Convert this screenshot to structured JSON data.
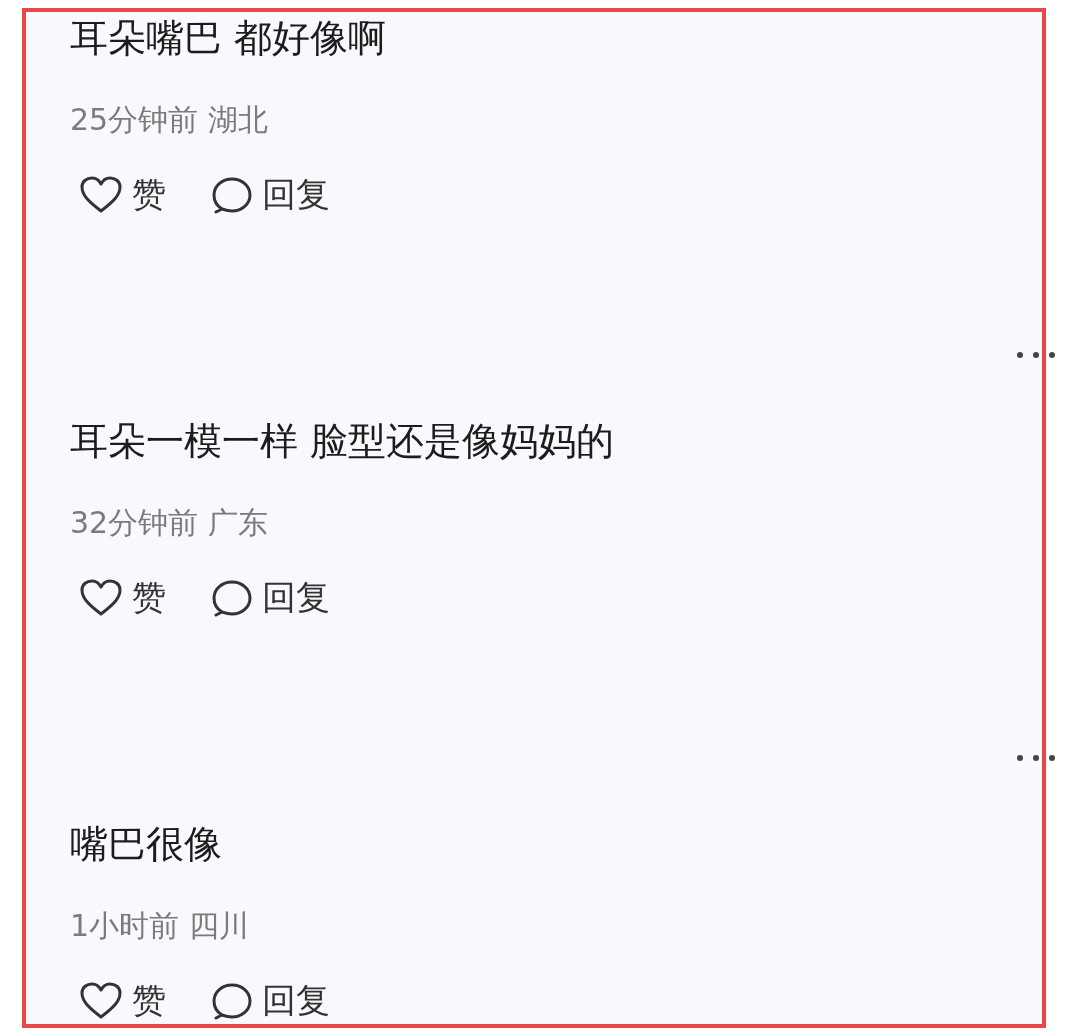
{
  "comments": [
    {
      "text": "耳朵嘴巴 都好像啊",
      "time": "25分钟前",
      "location": "湖北",
      "like_label": "赞",
      "reply_label": "回复",
      "more": false
    },
    {
      "text": "耳朵一模一样 脸型还是像妈妈的",
      "time": "32分钟前",
      "location": "广东",
      "like_label": "赞",
      "reply_label": "回复",
      "more": true
    },
    {
      "text": "嘴巴很像",
      "time": "1小时前",
      "location": "四川",
      "like_label": "赞",
      "reply_label": "回复",
      "more": true
    }
  ]
}
